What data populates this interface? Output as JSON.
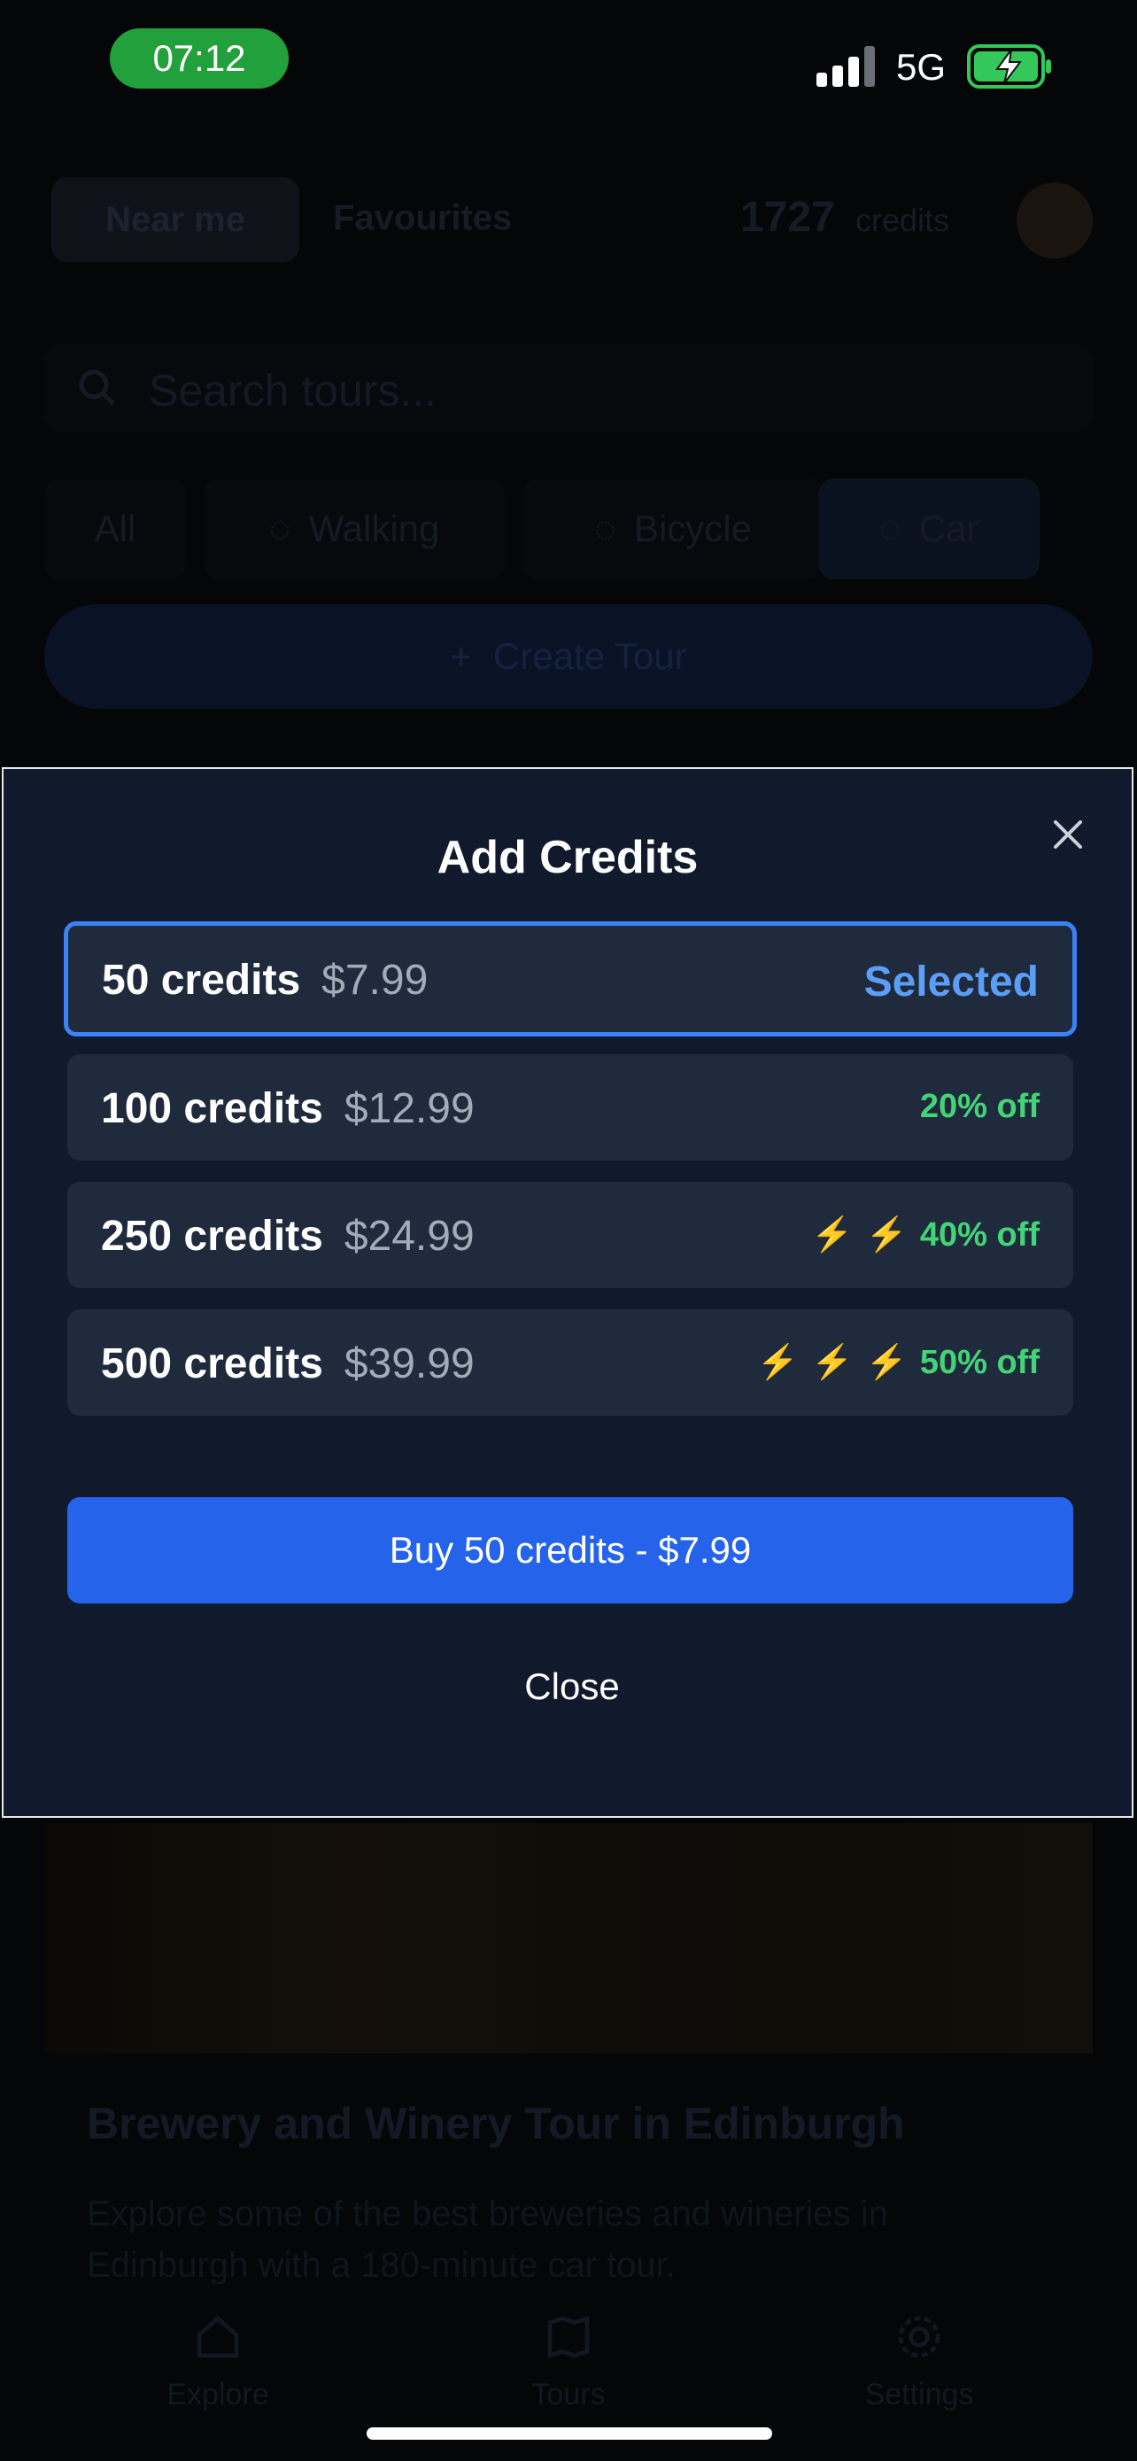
{
  "status_bar": {
    "time": "07:12",
    "network": "5G"
  },
  "background": {
    "tabs": {
      "near_me": "Near me",
      "favourites": "Favourites"
    },
    "credits": {
      "count": "1727",
      "label": "credits"
    },
    "search": {
      "placeholder": "Search tours..."
    },
    "filters": [
      "All",
      "Walking",
      "Bicycle",
      "Car"
    ],
    "create_tour_label": "Create Tour",
    "tour_card": {
      "title": "Brewery and Winery Tour in Edinburgh",
      "description": "Explore some of the best breweries and wineries in Edinburgh with a 180-minute car tour."
    },
    "nav": [
      "Explore",
      "Tours",
      "Settings"
    ]
  },
  "modal": {
    "title": "Add Credits",
    "options": [
      {
        "credits": "50 credits",
        "price": "$7.99",
        "badge": "Selected",
        "bolts": 0,
        "selected": true
      },
      {
        "credits": "100 credits",
        "price": "$12.99",
        "badge": "20% off",
        "bolts": 0,
        "selected": false
      },
      {
        "credits": "250 credits",
        "price": "$24.99",
        "badge": "40% off",
        "bolts": 2,
        "selected": false
      },
      {
        "credits": "500 credits",
        "price": "$39.99",
        "badge": "50% off",
        "bolts": 3,
        "selected": false
      }
    ],
    "buy_label": "Buy 50 credits - $7.99",
    "close_label": "Close"
  },
  "colors": {
    "accent": "#2563eb",
    "selected_border": "#3b82f6",
    "discount_green": "#43d477",
    "bolt_yellow": "#f5b21d",
    "time_pill": "#22a03b"
  }
}
